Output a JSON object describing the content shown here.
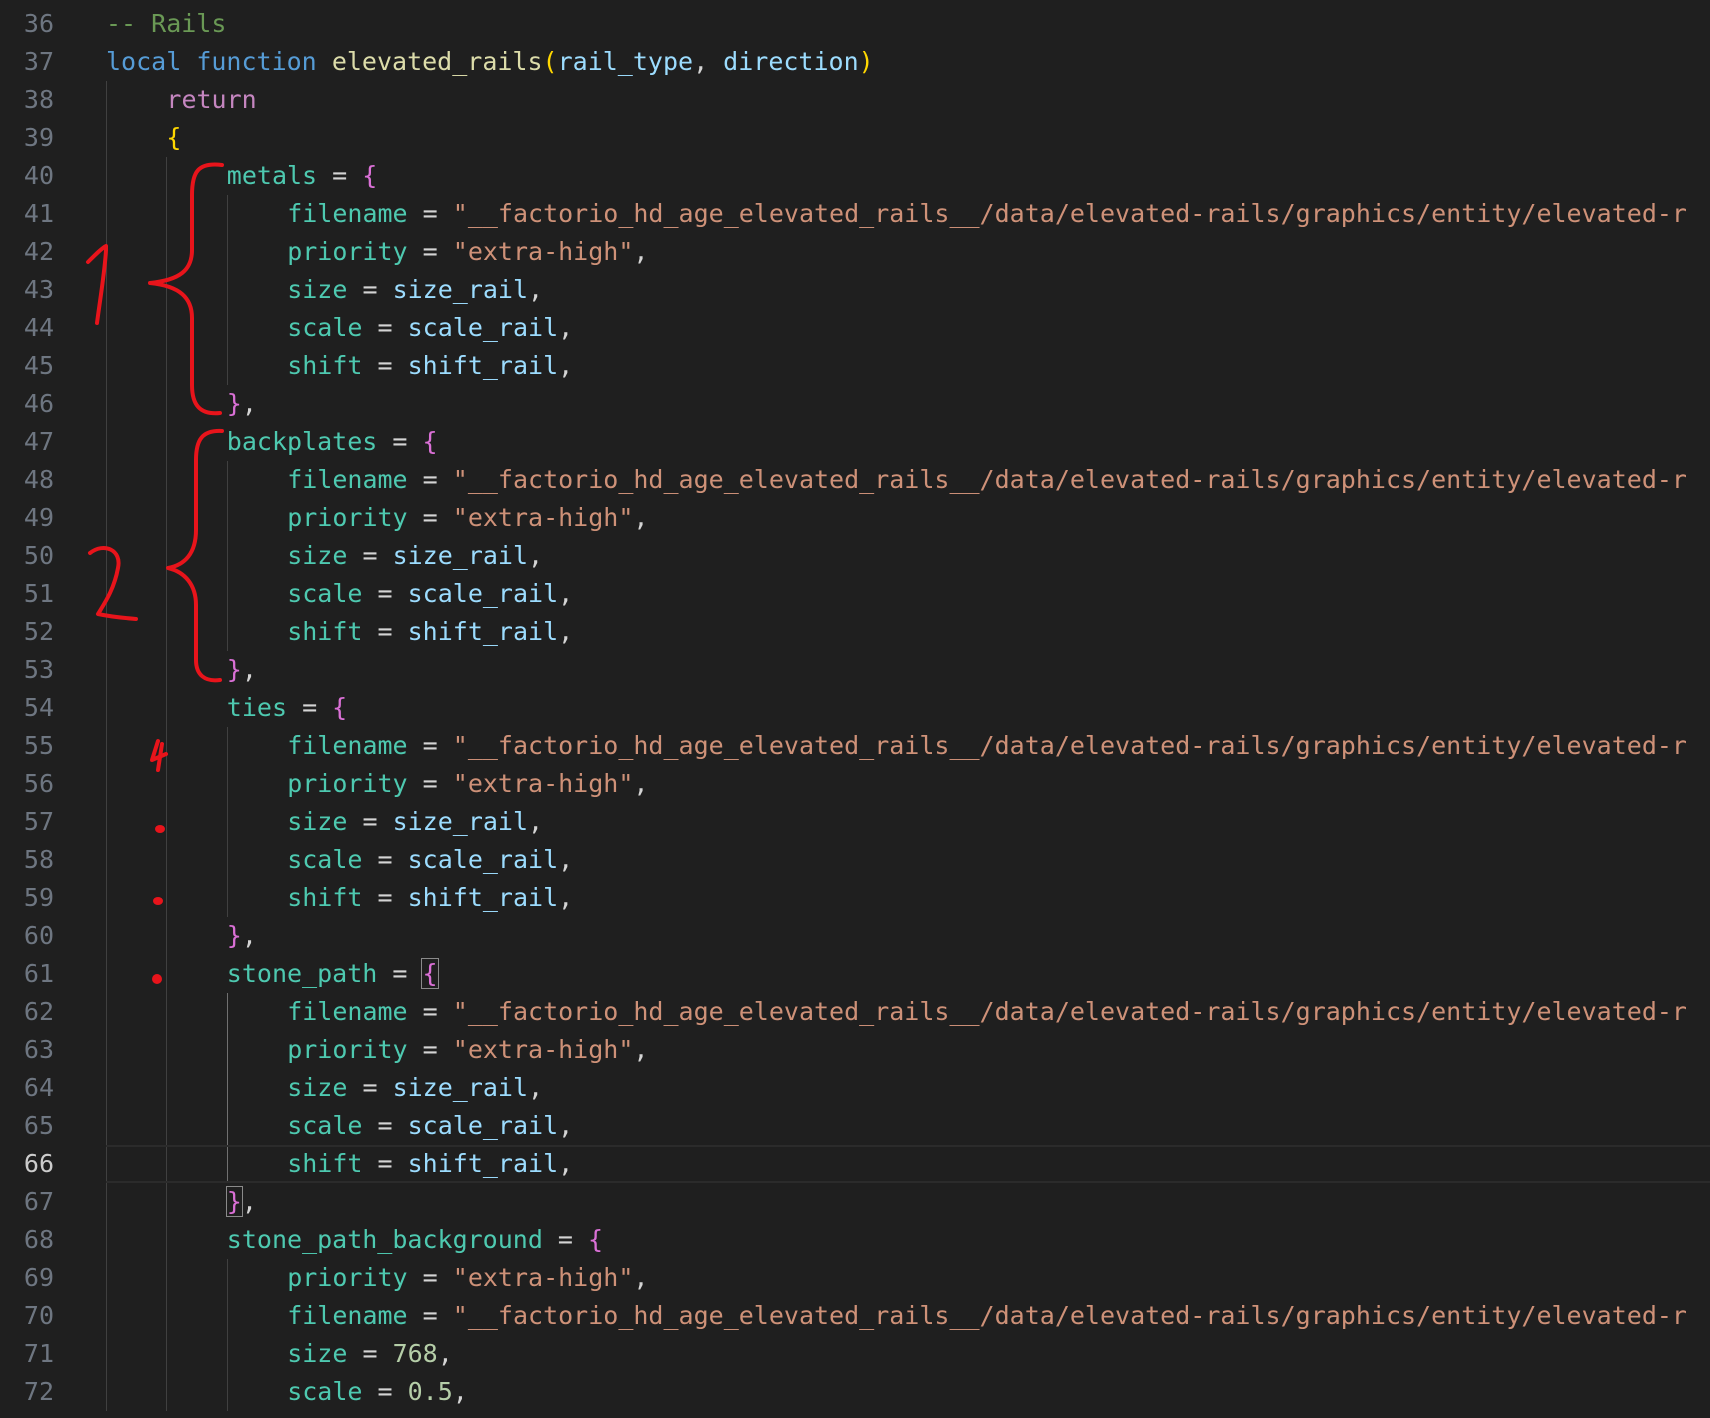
{
  "editor": {
    "colors": {
      "background": "#1f1f1f",
      "line_number": "#6e7681",
      "line_number_active": "#cccccc",
      "comment": "#6a9955",
      "keyword": "#569cd6",
      "control": "#c586c0",
      "function": "#dcdcaa",
      "parameter": "#9cdcfe",
      "property": "#4ec9b0",
      "string": "#ce9178",
      "number": "#b5cea8",
      "variable": "#9cdcfe",
      "operator": "#d4d4d4",
      "brace_level1": "#ffd700",
      "brace_level2": "#da70d6",
      "annotation_ink": "#e8141b"
    },
    "active_line": 66,
    "lines": [
      {
        "n": "36",
        "indent": 0,
        "tokens": [
          {
            "t": "-- Rails",
            "c": "comment"
          }
        ]
      },
      {
        "n": "37",
        "indent": 0,
        "tokens": [
          {
            "t": "local",
            "c": "keyword"
          },
          {
            "t": " ",
            "c": "operator"
          },
          {
            "t": "function",
            "c": "keyword"
          },
          {
            "t": " ",
            "c": "operator"
          },
          {
            "t": "elevated_rails",
            "c": "function"
          },
          {
            "t": "(",
            "c": "brace_level1"
          },
          {
            "t": "rail_type",
            "c": "parameter"
          },
          {
            "t": ", ",
            "c": "operator"
          },
          {
            "t": "direction",
            "c": "parameter"
          },
          {
            "t": ")",
            "c": "brace_level1"
          }
        ]
      },
      {
        "n": "38",
        "indent": 1,
        "tokens": [
          {
            "t": "return",
            "c": "control"
          }
        ]
      },
      {
        "n": "39",
        "indent": 1,
        "tokens": [
          {
            "t": "{",
            "c": "brace_level1"
          }
        ]
      },
      {
        "n": "40",
        "indent": 2,
        "tokens": [
          {
            "t": "metals",
            "c": "property"
          },
          {
            "t": " = ",
            "c": "operator"
          },
          {
            "t": "{",
            "c": "brace_level2"
          }
        ]
      },
      {
        "n": "41",
        "indent": 3,
        "tokens": [
          {
            "t": "filename",
            "c": "property"
          },
          {
            "t": " = ",
            "c": "operator"
          },
          {
            "t": "\"__factorio_hd_age_elevated_rails__/data/elevated-rails/graphics/entity/elevated-r",
            "c": "string"
          }
        ]
      },
      {
        "n": "42",
        "indent": 3,
        "tokens": [
          {
            "t": "priority",
            "c": "property"
          },
          {
            "t": " = ",
            "c": "operator"
          },
          {
            "t": "\"extra-high\"",
            "c": "string"
          },
          {
            "t": ",",
            "c": "operator"
          }
        ]
      },
      {
        "n": "43",
        "indent": 3,
        "tokens": [
          {
            "t": "size",
            "c": "property"
          },
          {
            "t": " = ",
            "c": "operator"
          },
          {
            "t": "size_rail",
            "c": "variable"
          },
          {
            "t": ",",
            "c": "operator"
          }
        ]
      },
      {
        "n": "44",
        "indent": 3,
        "tokens": [
          {
            "t": "scale",
            "c": "property"
          },
          {
            "t": " = ",
            "c": "operator"
          },
          {
            "t": "scale_rail",
            "c": "variable"
          },
          {
            "t": ",",
            "c": "operator"
          }
        ]
      },
      {
        "n": "45",
        "indent": 3,
        "tokens": [
          {
            "t": "shift",
            "c": "property"
          },
          {
            "t": " = ",
            "c": "operator"
          },
          {
            "t": "shift_rail",
            "c": "variable"
          },
          {
            "t": ",",
            "c": "operator"
          }
        ]
      },
      {
        "n": "46",
        "indent": 2,
        "tokens": [
          {
            "t": "}",
            "c": "brace_level2"
          },
          {
            "t": ",",
            "c": "operator"
          }
        ]
      },
      {
        "n": "47",
        "indent": 2,
        "tokens": [
          {
            "t": "backplates",
            "c": "property"
          },
          {
            "t": " = ",
            "c": "operator"
          },
          {
            "t": "{",
            "c": "brace_level2"
          }
        ]
      },
      {
        "n": "48",
        "indent": 3,
        "tokens": [
          {
            "t": "filename",
            "c": "property"
          },
          {
            "t": " = ",
            "c": "operator"
          },
          {
            "t": "\"__factorio_hd_age_elevated_rails__/data/elevated-rails/graphics/entity/elevated-r",
            "c": "string"
          }
        ]
      },
      {
        "n": "49",
        "indent": 3,
        "tokens": [
          {
            "t": "priority",
            "c": "property"
          },
          {
            "t": " = ",
            "c": "operator"
          },
          {
            "t": "\"extra-high\"",
            "c": "string"
          },
          {
            "t": ",",
            "c": "operator"
          }
        ]
      },
      {
        "n": "50",
        "indent": 3,
        "tokens": [
          {
            "t": "size",
            "c": "property"
          },
          {
            "t": " = ",
            "c": "operator"
          },
          {
            "t": "size_rail",
            "c": "variable"
          },
          {
            "t": ",",
            "c": "operator"
          }
        ]
      },
      {
        "n": "51",
        "indent": 3,
        "tokens": [
          {
            "t": "scale",
            "c": "property"
          },
          {
            "t": " = ",
            "c": "operator"
          },
          {
            "t": "scale_rail",
            "c": "variable"
          },
          {
            "t": ",",
            "c": "operator"
          }
        ]
      },
      {
        "n": "52",
        "indent": 3,
        "tokens": [
          {
            "t": "shift",
            "c": "property"
          },
          {
            "t": " = ",
            "c": "operator"
          },
          {
            "t": "shift_rail",
            "c": "variable"
          },
          {
            "t": ",",
            "c": "operator"
          }
        ]
      },
      {
        "n": "53",
        "indent": 2,
        "tokens": [
          {
            "t": "}",
            "c": "brace_level2"
          },
          {
            "t": ",",
            "c": "operator"
          }
        ]
      },
      {
        "n": "54",
        "indent": 2,
        "tokens": [
          {
            "t": "ties",
            "c": "property"
          },
          {
            "t": " = ",
            "c": "operator"
          },
          {
            "t": "{",
            "c": "brace_level2"
          }
        ]
      },
      {
        "n": "55",
        "indent": 3,
        "tokens": [
          {
            "t": "filename",
            "c": "property"
          },
          {
            "t": " = ",
            "c": "operator"
          },
          {
            "t": "\"__factorio_hd_age_elevated_rails__/data/elevated-rails/graphics/entity/elevated-r",
            "c": "string"
          }
        ]
      },
      {
        "n": "56",
        "indent": 3,
        "tokens": [
          {
            "t": "priority",
            "c": "property"
          },
          {
            "t": " = ",
            "c": "operator"
          },
          {
            "t": "\"extra-high\"",
            "c": "string"
          },
          {
            "t": ",",
            "c": "operator"
          }
        ]
      },
      {
        "n": "57",
        "indent": 3,
        "tokens": [
          {
            "t": "size",
            "c": "property"
          },
          {
            "t": " = ",
            "c": "operator"
          },
          {
            "t": "size_rail",
            "c": "variable"
          },
          {
            "t": ",",
            "c": "operator"
          }
        ]
      },
      {
        "n": "58",
        "indent": 3,
        "tokens": [
          {
            "t": "scale",
            "c": "property"
          },
          {
            "t": " = ",
            "c": "operator"
          },
          {
            "t": "scale_rail",
            "c": "variable"
          },
          {
            "t": ",",
            "c": "operator"
          }
        ]
      },
      {
        "n": "59",
        "indent": 3,
        "tokens": [
          {
            "t": "shift",
            "c": "property"
          },
          {
            "t": " = ",
            "c": "operator"
          },
          {
            "t": "shift_rail",
            "c": "variable"
          },
          {
            "t": ",",
            "c": "operator"
          }
        ]
      },
      {
        "n": "60",
        "indent": 2,
        "tokens": [
          {
            "t": "}",
            "c": "brace_level2"
          },
          {
            "t": ",",
            "c": "operator"
          }
        ]
      },
      {
        "n": "61",
        "indent": 2,
        "tokens": [
          {
            "t": "stone_path",
            "c": "property"
          },
          {
            "t": " = ",
            "c": "operator"
          },
          {
            "t": "{",
            "c": "brace_level2",
            "box": true
          }
        ]
      },
      {
        "n": "62",
        "indent": 3,
        "tokens": [
          {
            "t": "filename",
            "c": "property"
          },
          {
            "t": " = ",
            "c": "operator"
          },
          {
            "t": "\"__factorio_hd_age_elevated_rails__/data/elevated-rails/graphics/entity/elevated-r",
            "c": "string"
          }
        ]
      },
      {
        "n": "63",
        "indent": 3,
        "tokens": [
          {
            "t": "priority",
            "c": "property"
          },
          {
            "t": " = ",
            "c": "operator"
          },
          {
            "t": "\"extra-high\"",
            "c": "string"
          },
          {
            "t": ",",
            "c": "operator"
          }
        ]
      },
      {
        "n": "64",
        "indent": 3,
        "tokens": [
          {
            "t": "size",
            "c": "property"
          },
          {
            "t": " = ",
            "c": "operator"
          },
          {
            "t": "size_rail",
            "c": "variable"
          },
          {
            "t": ",",
            "c": "operator"
          }
        ]
      },
      {
        "n": "65",
        "indent": 3,
        "tokens": [
          {
            "t": "scale",
            "c": "property"
          },
          {
            "t": " = ",
            "c": "operator"
          },
          {
            "t": "scale_rail",
            "c": "variable"
          },
          {
            "t": ",",
            "c": "operator"
          }
        ]
      },
      {
        "n": "66",
        "indent": 3,
        "tokens": [
          {
            "t": "shift",
            "c": "property"
          },
          {
            "t": " = ",
            "c": "operator"
          },
          {
            "t": "shift_rail",
            "c": "variable"
          },
          {
            "t": ",",
            "c": "operator"
          }
        ]
      },
      {
        "n": "67",
        "indent": 2,
        "tokens": [
          {
            "t": "}",
            "c": "brace_level2",
            "box": true
          },
          {
            "t": ",",
            "c": "operator"
          }
        ]
      },
      {
        "n": "68",
        "indent": 2,
        "tokens": [
          {
            "t": "stone_path_background",
            "c": "property"
          },
          {
            "t": " = ",
            "c": "operator"
          },
          {
            "t": "{",
            "c": "brace_level2"
          }
        ]
      },
      {
        "n": "69",
        "indent": 3,
        "tokens": [
          {
            "t": "priority",
            "c": "property"
          },
          {
            "t": " = ",
            "c": "operator"
          },
          {
            "t": "\"extra-high\"",
            "c": "string"
          },
          {
            "t": ",",
            "c": "operator"
          }
        ]
      },
      {
        "n": "70",
        "indent": 3,
        "tokens": [
          {
            "t": "filename",
            "c": "property"
          },
          {
            "t": " = ",
            "c": "operator"
          },
          {
            "t": "\"__factorio_hd_age_elevated_rails__/data/elevated-rails/graphics/entity/elevated-r",
            "c": "string"
          }
        ]
      },
      {
        "n": "71",
        "indent": 3,
        "tokens": [
          {
            "t": "size",
            "c": "property"
          },
          {
            "t": " = ",
            "c": "operator"
          },
          {
            "t": "768",
            "c": "number"
          },
          {
            "t": ",",
            "c": "operator"
          }
        ]
      },
      {
        "n": "72",
        "indent": 3,
        "tokens": [
          {
            "t": "scale",
            "c": "property"
          },
          {
            "t": " = ",
            "c": "operator"
          },
          {
            "t": "0.5",
            "c": "number"
          },
          {
            "t": ",",
            "c": "operator"
          }
        ]
      }
    ]
  },
  "annotations": {
    "group_labels": [
      "1",
      "2"
    ]
  }
}
